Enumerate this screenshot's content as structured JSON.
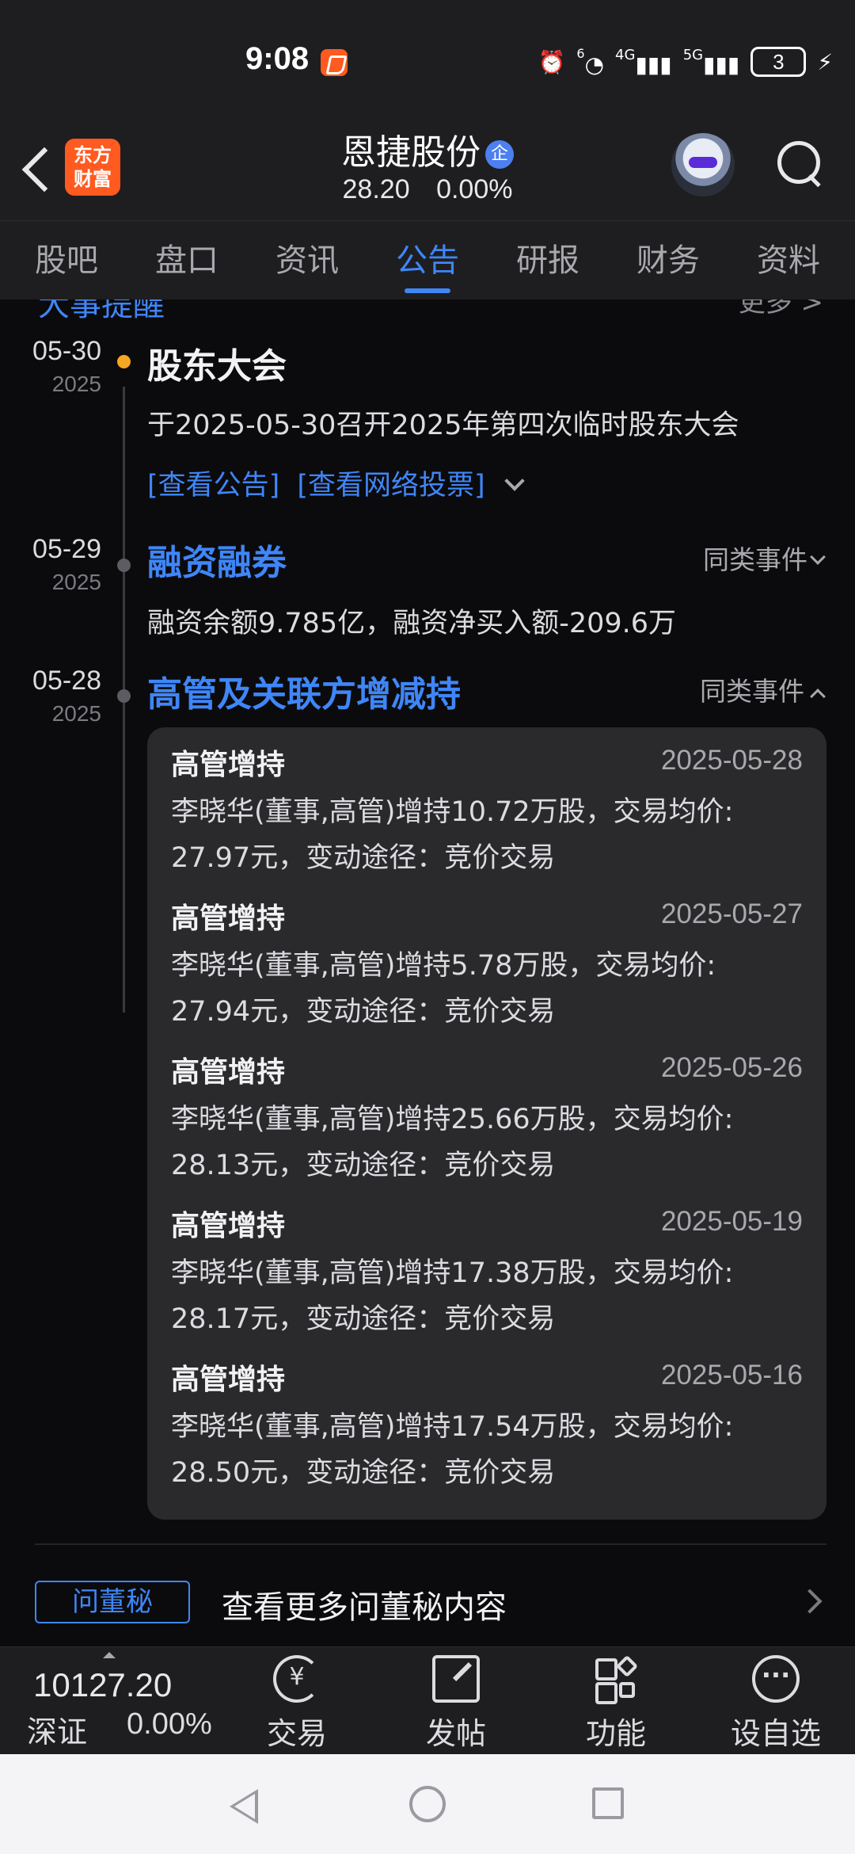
{
  "status_bar": {
    "time": "9:08",
    "battery": "3",
    "signal_labels": [
      "6",
      "4G",
      "5G"
    ]
  },
  "header": {
    "logo_text": "东方\n财富",
    "stock_name": "恩捷股份",
    "badge": "企",
    "price": "28.20",
    "change": "0.00%"
  },
  "tabs": [
    "股吧",
    "盘口",
    "资讯",
    "公告",
    "研报",
    "财务",
    "资料"
  ],
  "active_tab": "公告",
  "section_peek": {
    "left": "大事提醒",
    "right": "更多 >"
  },
  "events": [
    {
      "md": "05-30",
      "year": "2025",
      "title": "股东大会",
      "desc": "于2025-05-30召开2025年第四次临时股东大会",
      "links": [
        "[查看公告]",
        "[查看网络投票]"
      ]
    },
    {
      "md": "05-29",
      "year": "2025",
      "title": "融资融券",
      "desc": "融资余额9.785亿，融资净买入额-209.6万",
      "similar": "同类事件"
    },
    {
      "md": "05-28",
      "year": "2025",
      "title": "高管及关联方增减持",
      "similar": "同类事件"
    }
  ],
  "records": [
    {
      "title": "高管增持",
      "date": "2025-05-28",
      "line1": "李晓华(董事,高管)增持10.72万股，交易均价:",
      "line2": "27.97元，变动途径：竞价交易"
    },
    {
      "title": "高管增持",
      "date": "2025-05-27",
      "line1": "李晓华(董事,高管)增持5.78万股，交易均价:",
      "line2": "27.94元，变动途径：竞价交易"
    },
    {
      "title": "高管增持",
      "date": "2025-05-26",
      "line1": "李晓华(董事,高管)增持25.66万股，交易均价:",
      "line2": "28.13元，变动途径：竞价交易"
    },
    {
      "title": "高管增持",
      "date": "2025-05-19",
      "line1": "李晓华(董事,高管)增持17.38万股，交易均价:",
      "line2": "28.17元，变动途径：竞价交易"
    },
    {
      "title": "高管增持",
      "date": "2025-05-16",
      "line1": "李晓华(董事,高管)增持17.54万股，交易均价:",
      "line2": "28.50元，变动途径：竞价交易"
    }
  ],
  "dong_mi": {
    "tag": "问董秘",
    "text": "查看更多问董秘内容"
  },
  "toolbar": {
    "index_value": "10127.20",
    "index_name": "深证",
    "index_change": "0.00%",
    "items": [
      {
        "label": "交易",
        "icon": "trade-icon"
      },
      {
        "label": "发帖",
        "icon": "post-icon"
      },
      {
        "label": "功能",
        "icon": "function-icon"
      },
      {
        "label": "设自选",
        "icon": "more-icon"
      }
    ]
  },
  "colors": {
    "accent": "#3f86f7",
    "brand": "#ff5a1f",
    "timeline_dot_active": "#f5a623",
    "background": "#0b0b0d",
    "card": "#2a2a2d"
  }
}
